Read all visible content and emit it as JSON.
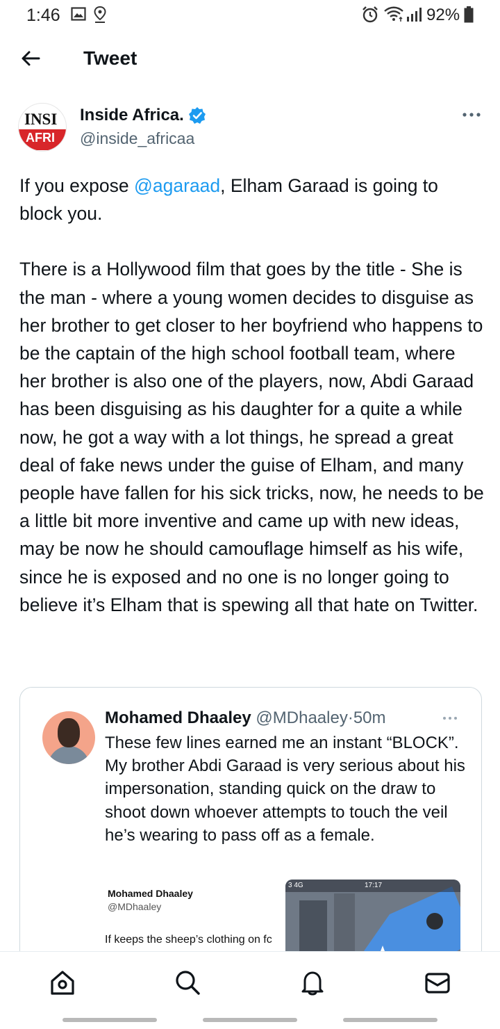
{
  "status_bar": {
    "time": "1:46",
    "battery": "92%",
    "icons": [
      "image-icon",
      "location-icon",
      "alarm-icon",
      "wifi-icon",
      "signal-icon",
      "battery-icon"
    ]
  },
  "header": {
    "title": "Tweet",
    "back_icon": "arrow-left-icon"
  },
  "tweet": {
    "author": {
      "name": "Inside Africa.",
      "handle": "@inside_africaa",
      "verified": true,
      "avatar_logo_top": "INSI",
      "avatar_logo_bottom": "AFRI"
    },
    "text_before_mention": "If you expose ",
    "mention": "@agaraad",
    "text_after_mention": ", Elham Garaad is going to block you.",
    "paragraph_2": "There is a Hollywood film that goes by the title - She is the man - where a young women decides to disguise as her brother to get closer to her boyfriend who happens to be the captain of the high school football team, where her brother is also one of the players, now, Abdi Garaad has been disguising as his daughter for a quite a while now, he got a way with a lot things, he spread a great deal of fake news under the guise of Elham, and many people have fallen for his sick tricks, now, he needs to be a little bit more inventive and came up with new ideas, may be now he should camouflage himself as his wife, since he is exposed and no one is no longer going to believe it’s Elham that is spewing all that hate on Twitter."
  },
  "quoted_tweet": {
    "name": "Mohamed Dhaaley",
    "handle": "@MDhaaley",
    "time": "50m",
    "text": "These few lines earned me an instant “BLOCK”. My brother Abdi Garaad is very serious about his impersonation, standing quick on the draw to shoot down whoever attempts to touch the veil he’s wearing to pass off as a female.",
    "embedded_shot": {
      "name": "Mohamed Dhaaley",
      "handle": "@MDhaaley",
      "text": "If keeps the sheep’s clothing on fc",
      "status_left": "3  4G",
      "status_time": "17:17"
    }
  },
  "bottom_nav": {
    "items": [
      "home-icon",
      "search-icon",
      "notifications-icon",
      "messages-icon"
    ]
  },
  "colors": {
    "accent": "#1d9bf0",
    "text": "#0f1419",
    "secondary": "#536471",
    "border": "#cfd9de",
    "logo_red": "#d8262a"
  }
}
